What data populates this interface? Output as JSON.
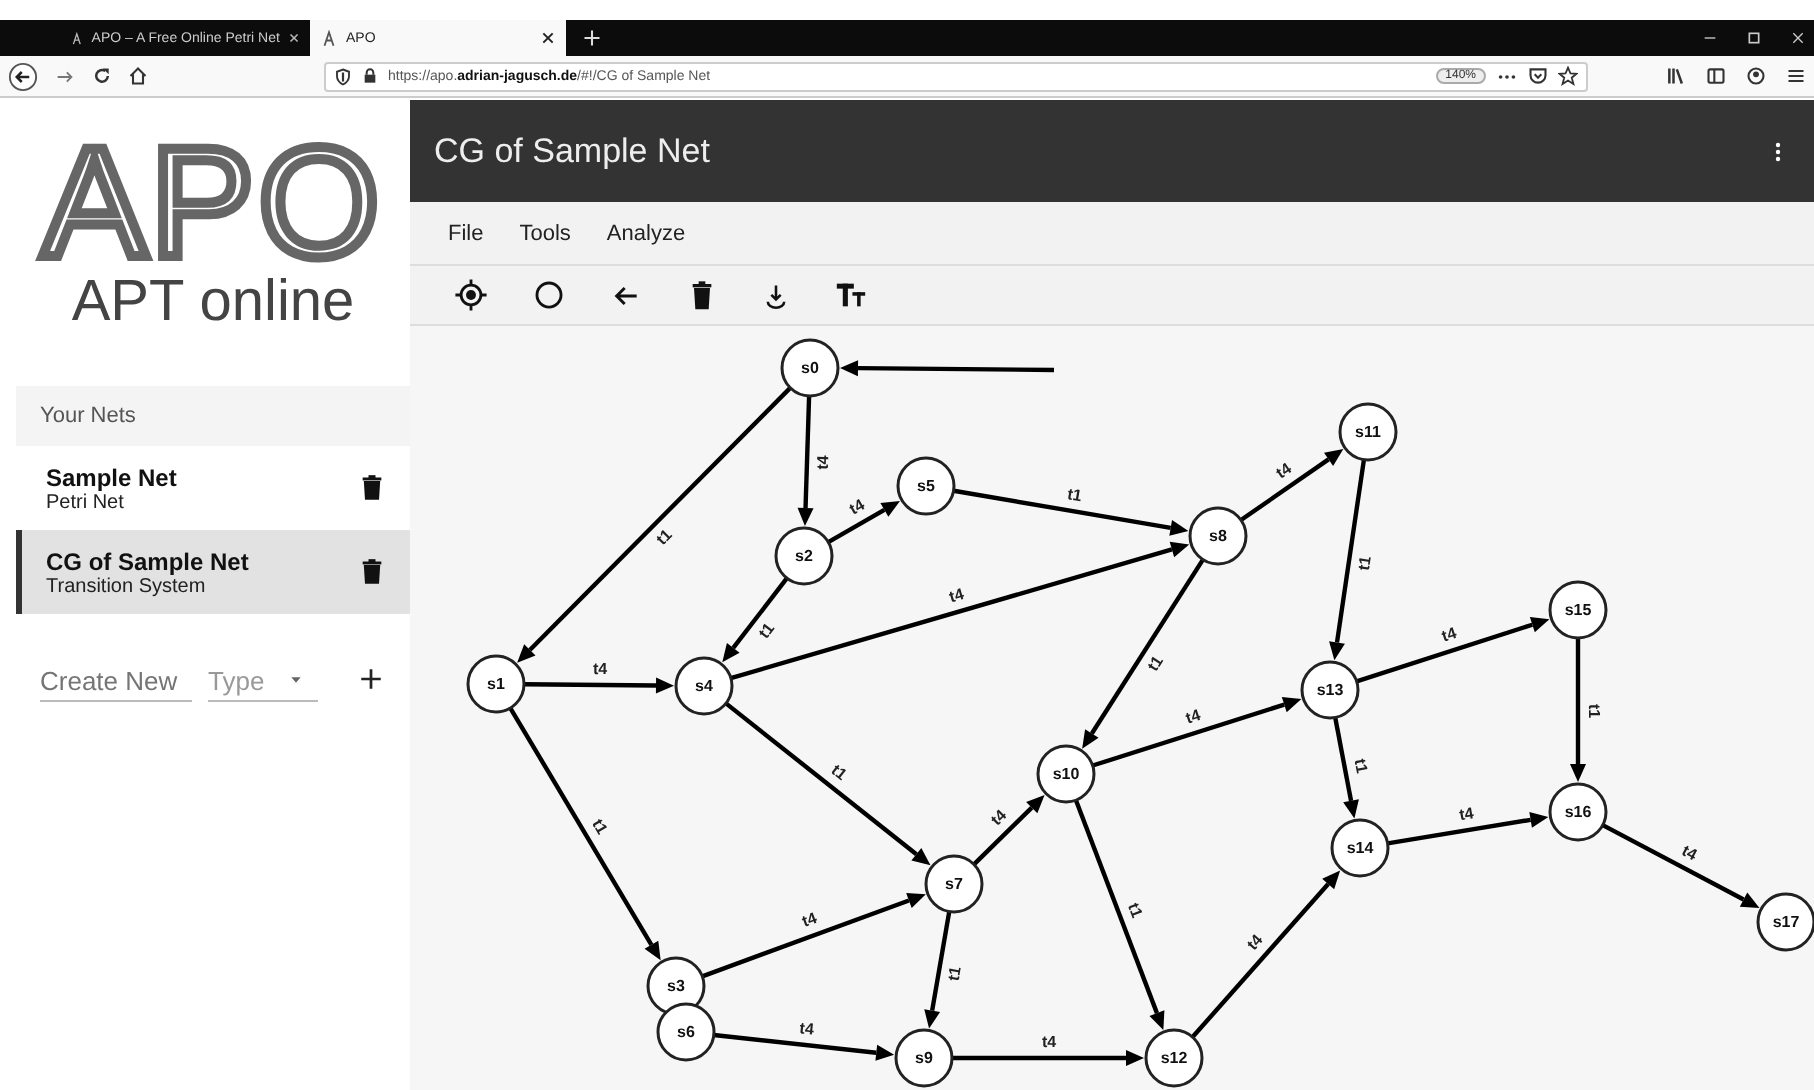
{
  "browser": {
    "tabs": [
      {
        "title": "APO – A Free Online Petri Net",
        "selected": false
      },
      {
        "title": "APO",
        "selected": true
      }
    ],
    "url": "https://apo.**adrian-jagusch.de**/#!/CG of Sample Net",
    "zoom": "140%"
  },
  "sidebar": {
    "logo": "APO",
    "tagline": "APT online",
    "section": "Your Nets",
    "nets": [
      {
        "name": "Sample Net",
        "type": "Petri Net",
        "selected": false
      },
      {
        "name": "CG of Sample Net",
        "type": "Transition System",
        "selected": true
      }
    ],
    "create": {
      "placeholder": "Create New",
      "type_placeholder": "Type"
    }
  },
  "header": {
    "title": "CG of Sample Net"
  },
  "menu": [
    "File",
    "Tools",
    "Analyze"
  ],
  "graph": {
    "nodes": [
      {
        "label": "s0",
        "out": [
          {
            "label": "t1"
          },
          {
            "label": "t4"
          }
        ]
      },
      {
        "label": "s1",
        "out": [
          {
            "label": "t4"
          },
          {
            "label": "t1"
          }
        ]
      },
      {
        "label": "s2",
        "out": [
          {
            "label": "t4"
          },
          {
            "label": "t1"
          }
        ]
      },
      {
        "label": "s3",
        "out": [
          {
            "label": "t4"
          }
        ]
      },
      {
        "label": "s4",
        "out": [
          {
            "label": "t4"
          },
          {
            "label": "t1"
          }
        ]
      },
      {
        "label": "s5",
        "out": [
          {
            "label": "t1"
          }
        ]
      },
      {
        "label": "s6",
        "out": [
          {
            "label": "t4"
          }
        ]
      },
      {
        "label": "s7",
        "out": [
          {
            "label": "t1"
          },
          {
            "label": "t4"
          }
        ]
      },
      {
        "label": "s8",
        "out": [
          {
            "label": "t1"
          },
          {
            "label": "t4"
          }
        ]
      },
      {
        "label": "s9",
        "out": [
          {
            "label": "t4"
          }
        ]
      },
      {
        "label": "s10",
        "out": [
          {
            "label": "t4"
          },
          {
            "label": "t1"
          }
        ]
      },
      {
        "label": "s11",
        "out": [
          {
            "label": "t1"
          }
        ]
      },
      {
        "label": "s12",
        "out": [
          {
            "label": "t4"
          }
        ]
      },
      {
        "label": "s13",
        "out": [
          {
            "label": "t4"
          },
          {
            "label": "t1"
          }
        ]
      },
      {
        "label": "s14",
        "out": [
          {
            "label": "t4"
          }
        ]
      },
      {
        "label": "s15",
        "out": [
          {
            "label": "t1"
          }
        ]
      },
      {
        "label": "s16",
        "out": [
          {
            "label": "t4"
          }
        ]
      },
      {
        "label": "s17"
      }
    ]
  }
}
